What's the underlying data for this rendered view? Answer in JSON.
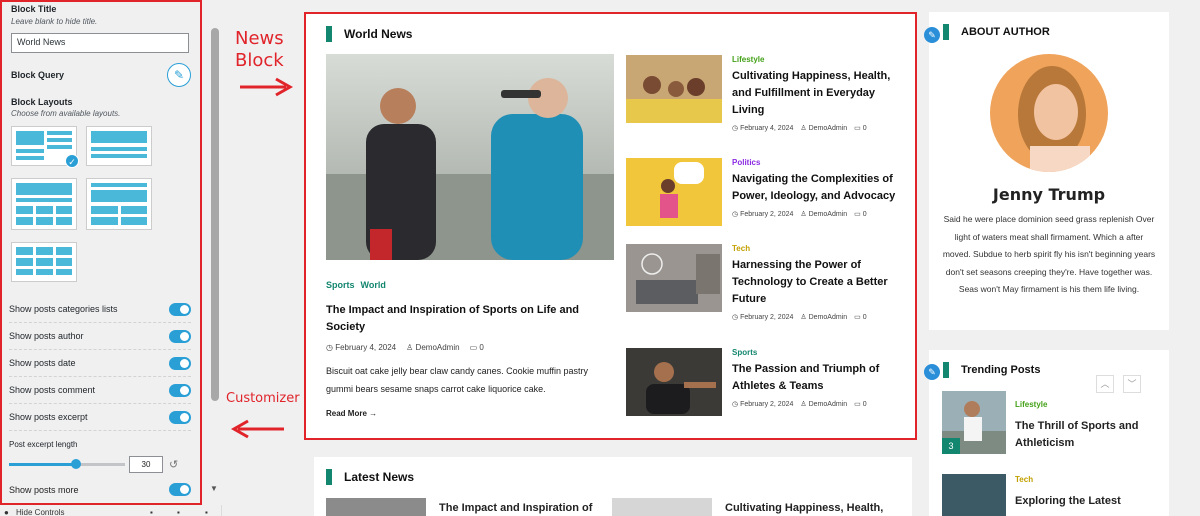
{
  "colors": {
    "accent": "#13866f",
    "annotation": "#e0242a",
    "wp_blue": "#2a9fd6",
    "politics": "#8a2be2",
    "tech": "#c2a000",
    "lifestyle": "#44a118"
  },
  "customizer": {
    "block_title_label": "Block Title",
    "block_title_hint": "Leave blank to hide title.",
    "block_title_value": "World News",
    "block_query_label": "Block Query",
    "block_layouts_label": "Block Layouts",
    "block_layouts_hint": "Choose from available layouts.",
    "layouts_selected": 1,
    "toggles": [
      {
        "label": "Show posts categories lists",
        "on": true
      },
      {
        "label": "Show posts author",
        "on": true
      },
      {
        "label": "Show posts date",
        "on": true
      },
      {
        "label": "Show posts comment",
        "on": true
      },
      {
        "label": "Show posts excerpt",
        "on": true
      }
    ],
    "excerpt_length_label": "Post excerpt length",
    "excerpt_length_value": "30",
    "show_more_label": "Show posts more",
    "hide_controls": "Hide Controls"
  },
  "annotations": {
    "news_block_line1": "News",
    "news_block_line2": "Block",
    "customizer": "Customizer"
  },
  "world_news": {
    "title": "World News",
    "main": {
      "cat1": "Sports",
      "cat2": "World",
      "title": "The Impact and Inspiration of Sports on Life and Society",
      "date": "February 4, 2024",
      "author": "DemoAdmin",
      "comments": "0",
      "excerpt": "Biscuit oat cake jelly bear claw candy canes. Cookie muffin pastry gummi bears sesame snaps carrot cake liquorice cake.",
      "read_more": "Read More"
    },
    "list": [
      {
        "cat": "Lifestyle",
        "title": "Cultivating Happiness, Health, and Fulfillment in Everyday Living",
        "date": "February 4, 2024",
        "author": "DemoAdmin",
        "comments": "0"
      },
      {
        "cat": "Politics",
        "title": "Navigating the Complexities of Power, Ideology, and Advocacy",
        "date": "February 2, 2024",
        "author": "DemoAdmin",
        "comments": "0"
      },
      {
        "cat": "Tech",
        "title": "Harnessing the Power of Technology to Create a Better Future",
        "date": "February 2, 2024",
        "author": "DemoAdmin",
        "comments": "0"
      },
      {
        "cat": "Sports",
        "title": "The Passion and Triumph of Athletes & Teams",
        "date": "February 2, 2024",
        "author": "DemoAdmin",
        "comments": "0"
      }
    ]
  },
  "latest_news": {
    "title": "Latest News",
    "items": [
      "The Impact and Inspiration of",
      "Cultivating Happiness, Health,"
    ]
  },
  "about_author": {
    "title": "ABOUT AUTHOR",
    "name": "Jenny Trump",
    "bio": "Said he were place dominion seed grass replenish Over light of waters meat shall firmament. Which a after moved. Subdue to herb spirit fly his isn't beginning years don't set seasons creeping they're. Have together was. Seas won't May firmament is his them life living."
  },
  "trending": {
    "title": "Trending Posts",
    "items": [
      {
        "cat": "Lifestyle",
        "title": "The Thrill of Sports and Athleticism",
        "rank": "3"
      },
      {
        "cat": "Tech",
        "title": "Exploring the Latest",
        "rank": ""
      }
    ]
  }
}
